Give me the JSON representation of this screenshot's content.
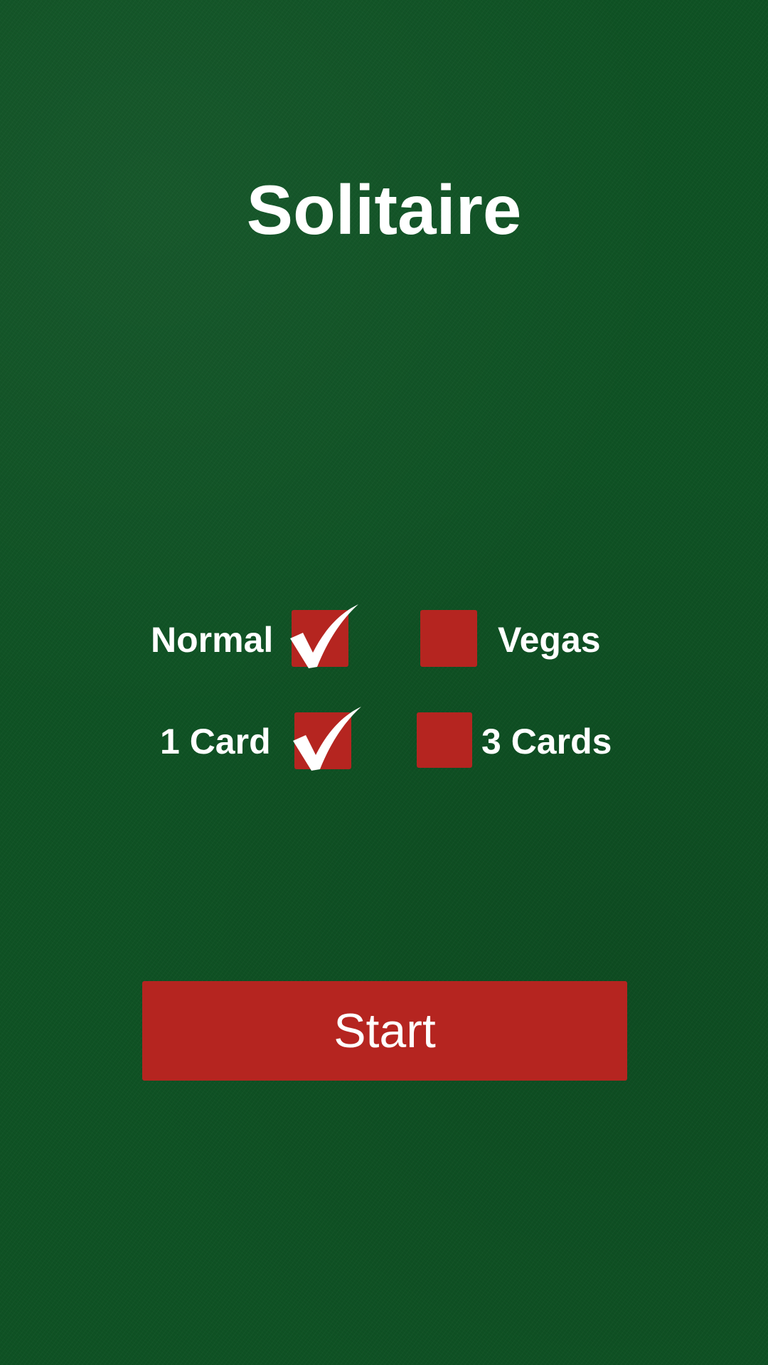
{
  "app": {
    "title": "Solitaire"
  },
  "options": {
    "mode": {
      "normal_label": "Normal",
      "normal_checked": true,
      "vegas_label": "Vegas",
      "vegas_checked": false
    },
    "draw": {
      "one_card_label": "1 Card",
      "one_card_checked": true,
      "three_cards_label": "3 Cards",
      "three_cards_checked": false
    }
  },
  "start_button": {
    "label": "Start"
  },
  "icons": {
    "checked": "checkmark-icon"
  },
  "colors": {
    "felt": "#0f5224",
    "accent": "#b52520",
    "text": "#ffffff"
  }
}
